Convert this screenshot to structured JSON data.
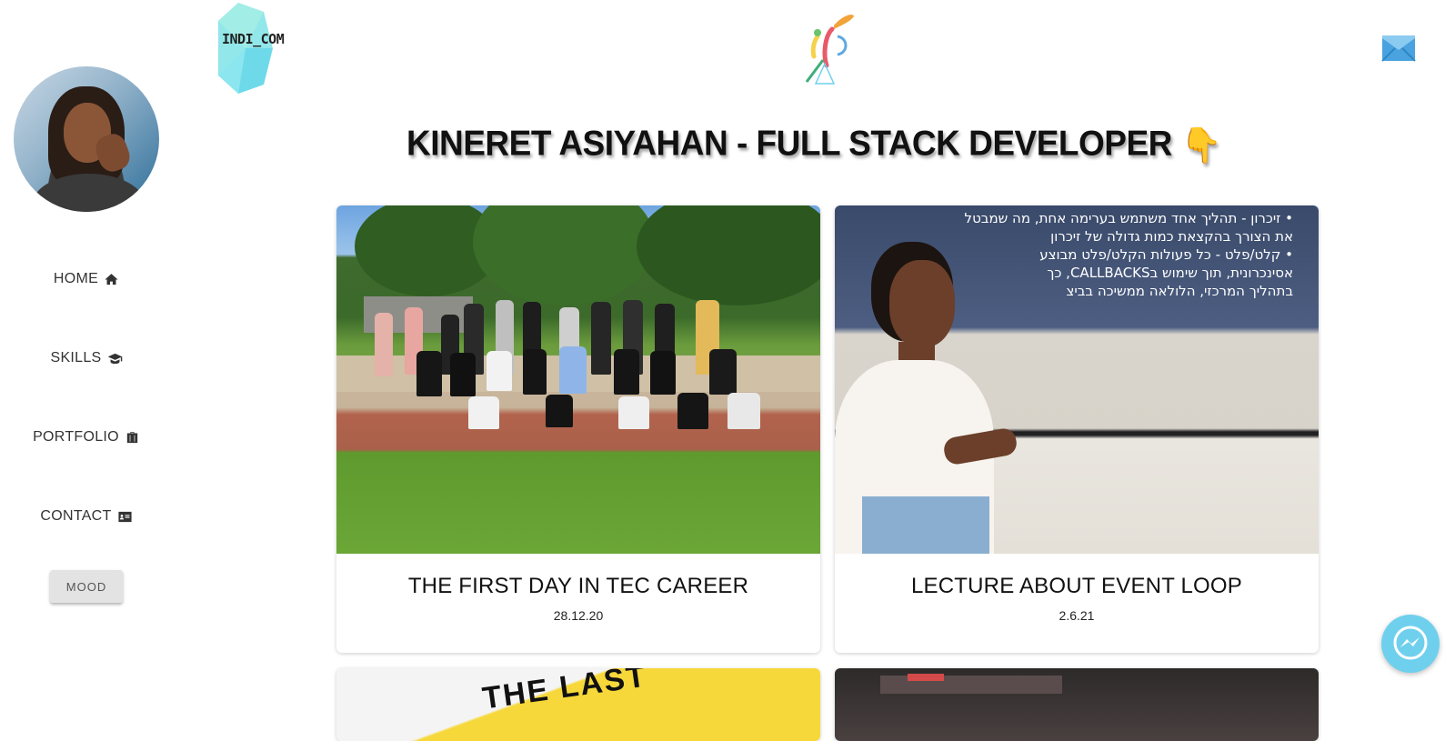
{
  "header": {
    "logo_text": "INDI_COM",
    "page_title": "KINERET ASIYAHAN - FULL STACK DEVELOPER",
    "pointer_emoji": "👇"
  },
  "sidebar": {
    "items": [
      {
        "label": "HOME",
        "icon": "home-icon"
      },
      {
        "label": "SKILLS",
        "icon": "graduation-cap-icon"
      },
      {
        "label": "PORTFOLIO",
        "icon": "briefcase-icon"
      },
      {
        "label": "CONTACT",
        "icon": "address-card-icon"
      }
    ],
    "mood_label": "MOOD"
  },
  "cards": [
    {
      "title": "THE FIRST DAY IN TEC CAREER",
      "date": "28.12.20"
    },
    {
      "title": "LECTURE ABOUT EVENT LOOP",
      "date": "2.6.21"
    }
  ],
  "lecture_slide": {
    "lines": [
      "• זיכרון - תהליך אחד משתמש בערימה אחת, מה שמבטל",
      "את הצורך בהקצאת כמות גדולה של זיכרון",
      "• קלט/פלט - כל פעולות הקלט/פלט מבוצע",
      "אסינכרונית, תוך שימוש בCALLBACKS, כך",
      "בתהליך המרכזי, הלולאה ממשיכה בביצ"
    ]
  },
  "partial_card_text": "THE LAST",
  "colors": {
    "accent": "#6fd0ee",
    "mail": "#4aa3df"
  }
}
